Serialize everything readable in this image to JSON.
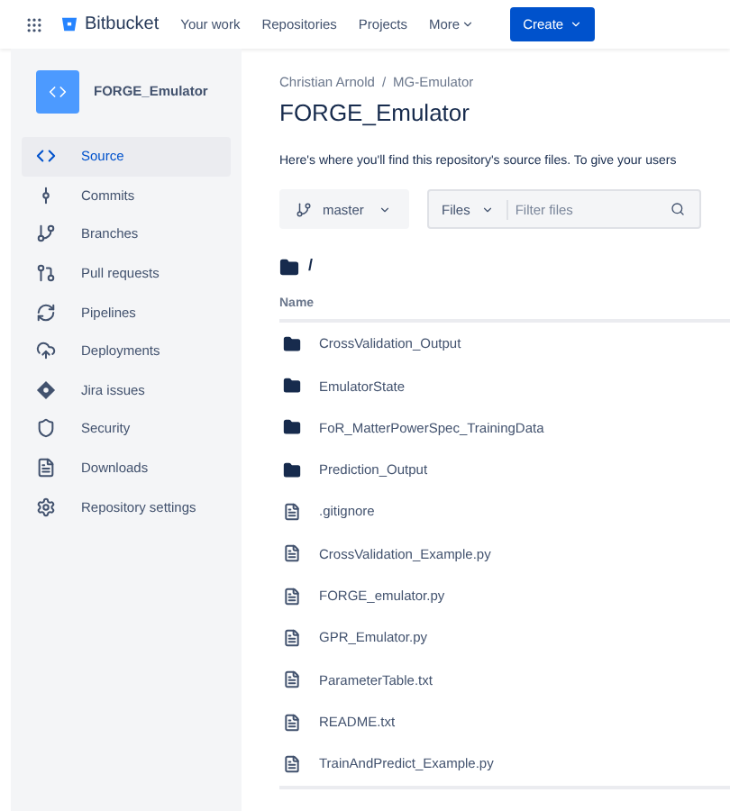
{
  "topbar": {
    "product": "Bitbucket",
    "nav": [
      "Your work",
      "Repositories",
      "Projects",
      "More"
    ],
    "create": "Create"
  },
  "sidebar": {
    "repo": "FORGE_Emulator",
    "items": [
      {
        "label": "Source",
        "kind": "code",
        "selected": true
      },
      {
        "label": "Commits",
        "kind": "commit",
        "selected": false
      },
      {
        "label": "Branches",
        "kind": "branch",
        "selected": false
      },
      {
        "label": "Pull requests",
        "kind": "pull",
        "selected": false
      },
      {
        "label": "Pipelines",
        "kind": "pipelines",
        "selected": false
      },
      {
        "label": "Deployments",
        "kind": "cloud",
        "selected": false
      },
      {
        "label": "Jira issues",
        "kind": "jira",
        "selected": false
      },
      {
        "label": "Security",
        "kind": "shield",
        "selected": false
      },
      {
        "label": "Downloads",
        "kind": "file",
        "selected": false
      },
      {
        "label": "Repository settings",
        "kind": "settings",
        "selected": false
      }
    ]
  },
  "breadcrumb": {
    "items": [
      "Christian Arnold",
      "MG-Emulator"
    ],
    "separator": "/"
  },
  "title": "FORGE_Emulator",
  "description": "Here's where you'll find this repository's source files. To give your users",
  "branch": "master",
  "files_dropdown": "Files",
  "filter": {
    "placeholder": "Filter files"
  },
  "path": "/",
  "table": {
    "columns": [
      "Name"
    ],
    "rows": [
      {
        "kind": "folder",
        "name": "CrossValidation_Output"
      },
      {
        "kind": "folder",
        "name": "EmulatorState"
      },
      {
        "kind": "folder",
        "name": "FoR_MatterPowerSpec_TrainingData"
      },
      {
        "kind": "folder",
        "name": "Prediction_Output"
      },
      {
        "kind": "file",
        "name": ".gitignore"
      },
      {
        "kind": "file",
        "name": "CrossValidation_Example.py"
      },
      {
        "kind": "file",
        "name": "FORGE_emulator.py"
      },
      {
        "kind": "file",
        "name": "GPR_Emulator.py"
      },
      {
        "kind": "file",
        "name": "ParameterTable.txt"
      },
      {
        "kind": "file",
        "name": "README.txt"
      },
      {
        "kind": "file",
        "name": "TrainAndPredict_Example.py"
      }
    ]
  }
}
